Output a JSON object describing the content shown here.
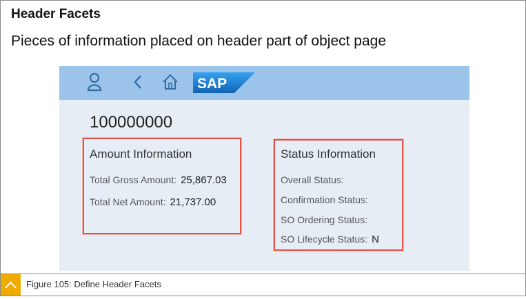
{
  "heading": "Header Facets",
  "subheading": "Pieces of information placed on header part of object page",
  "shell": {
    "icons": [
      "person-icon",
      "back-icon",
      "home-icon"
    ],
    "logo_text": "SAP"
  },
  "object_id": "100000000",
  "amount_facet": {
    "title": "Amount Information",
    "rows": [
      {
        "label": "Total Gross Amount:",
        "value": "25,867.03"
      },
      {
        "label": "Total Net Amount:",
        "value": "21,737.00"
      }
    ]
  },
  "status_facet": {
    "title": "Status Information",
    "rows": [
      {
        "label": "Overall Status:",
        "value": ""
      },
      {
        "label": "Confirmation Status:",
        "value": ""
      },
      {
        "label": "SO Ordering Status:",
        "value": ""
      },
      {
        "label": "SO Lifecycle Status:",
        "value": "N"
      }
    ]
  },
  "caption": "Figure 105: Define Header Facets",
  "colors": {
    "shellbar": "#9cc3ea",
    "shell_icon": "#2f6da6",
    "sap_blue": "#1b7ed4",
    "facet_border": "#e4534c",
    "caption_accent": "#f0ab00"
  }
}
